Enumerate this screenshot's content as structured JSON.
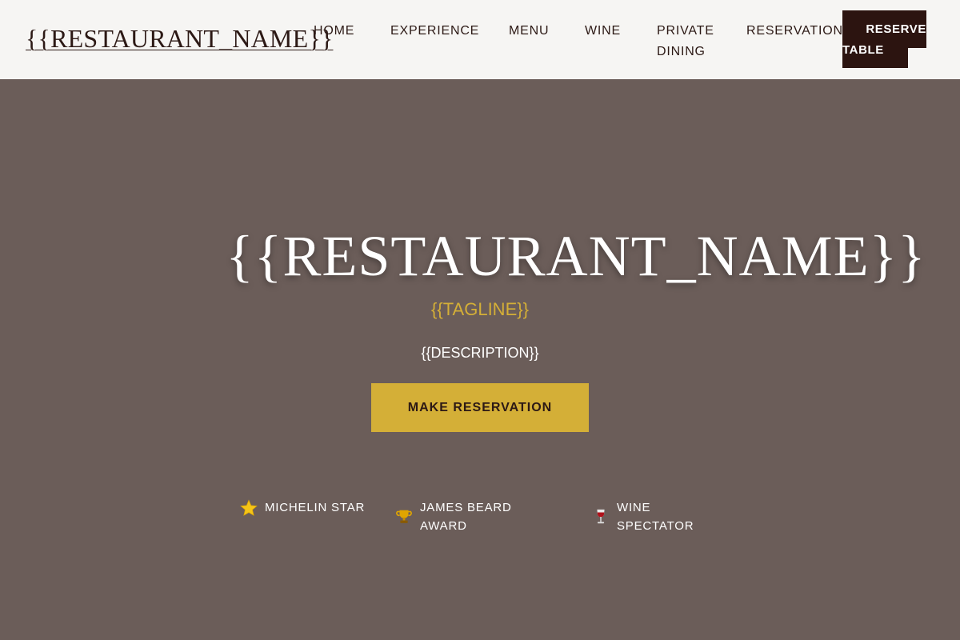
{
  "brand": {
    "logo_text": "{{RESTAURANT_NAME}}"
  },
  "nav": {
    "items": [
      {
        "label": "HOME"
      },
      {
        "label": "EXPERIENCE"
      },
      {
        "label": "MENU"
      },
      {
        "label": "WINE"
      },
      {
        "label": "PRIVATE DINING"
      },
      {
        "label": "RESERVATIONS"
      }
    ],
    "cta_line1": "RESERVE",
    "cta_line2": "TABLE"
  },
  "hero": {
    "title": "{{RESTAURANT_NAME}}",
    "tagline": "{{TAGLINE}}",
    "description": "{{DESCRIPTION}}",
    "button_label": "MAKE RESERVATION"
  },
  "awards": [
    {
      "icon": "star-icon",
      "label": "MICHELIN STAR"
    },
    {
      "icon": "trophy-icon",
      "label": "JAMES BEARD AWARD"
    },
    {
      "icon": "wine-glass-icon",
      "label": "WINE SPECTATOR"
    }
  ],
  "colors": {
    "nav_bg": "#f6f5f3",
    "text_dark": "#2c1915",
    "hero_bg": "#6b5d59",
    "accent_gold": "#d4af37",
    "button_dark": "#2c1410"
  }
}
